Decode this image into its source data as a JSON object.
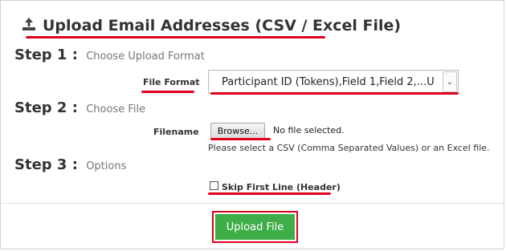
{
  "header": {
    "icon": "upload-icon",
    "title": "Upload Email Addresses (CSV / Excel File)"
  },
  "steps": [
    {
      "label": "Step 1 :",
      "sub": "Choose Upload Format"
    },
    {
      "label": "Step 2 :",
      "sub": "Choose File"
    },
    {
      "label": "Step 3 :",
      "sub": "Options"
    }
  ],
  "form": {
    "file_format_label": "File Format",
    "file_format_value": "Participant ID (Tokens),Field 1,Field 2,...U",
    "filename_label": "Filename",
    "browse_label": "Browse...",
    "no_file_text": "No file selected.",
    "help_text": "Please select a CSV (Comma Separated Values) or an Excel file.",
    "skip_first_line_label": "Skip First Line (Header)",
    "skip_first_line_checked": false,
    "upload_button_label": "Upload File"
  },
  "colors": {
    "annotation_red": "#e0001b",
    "button_green": "#3fae49"
  }
}
